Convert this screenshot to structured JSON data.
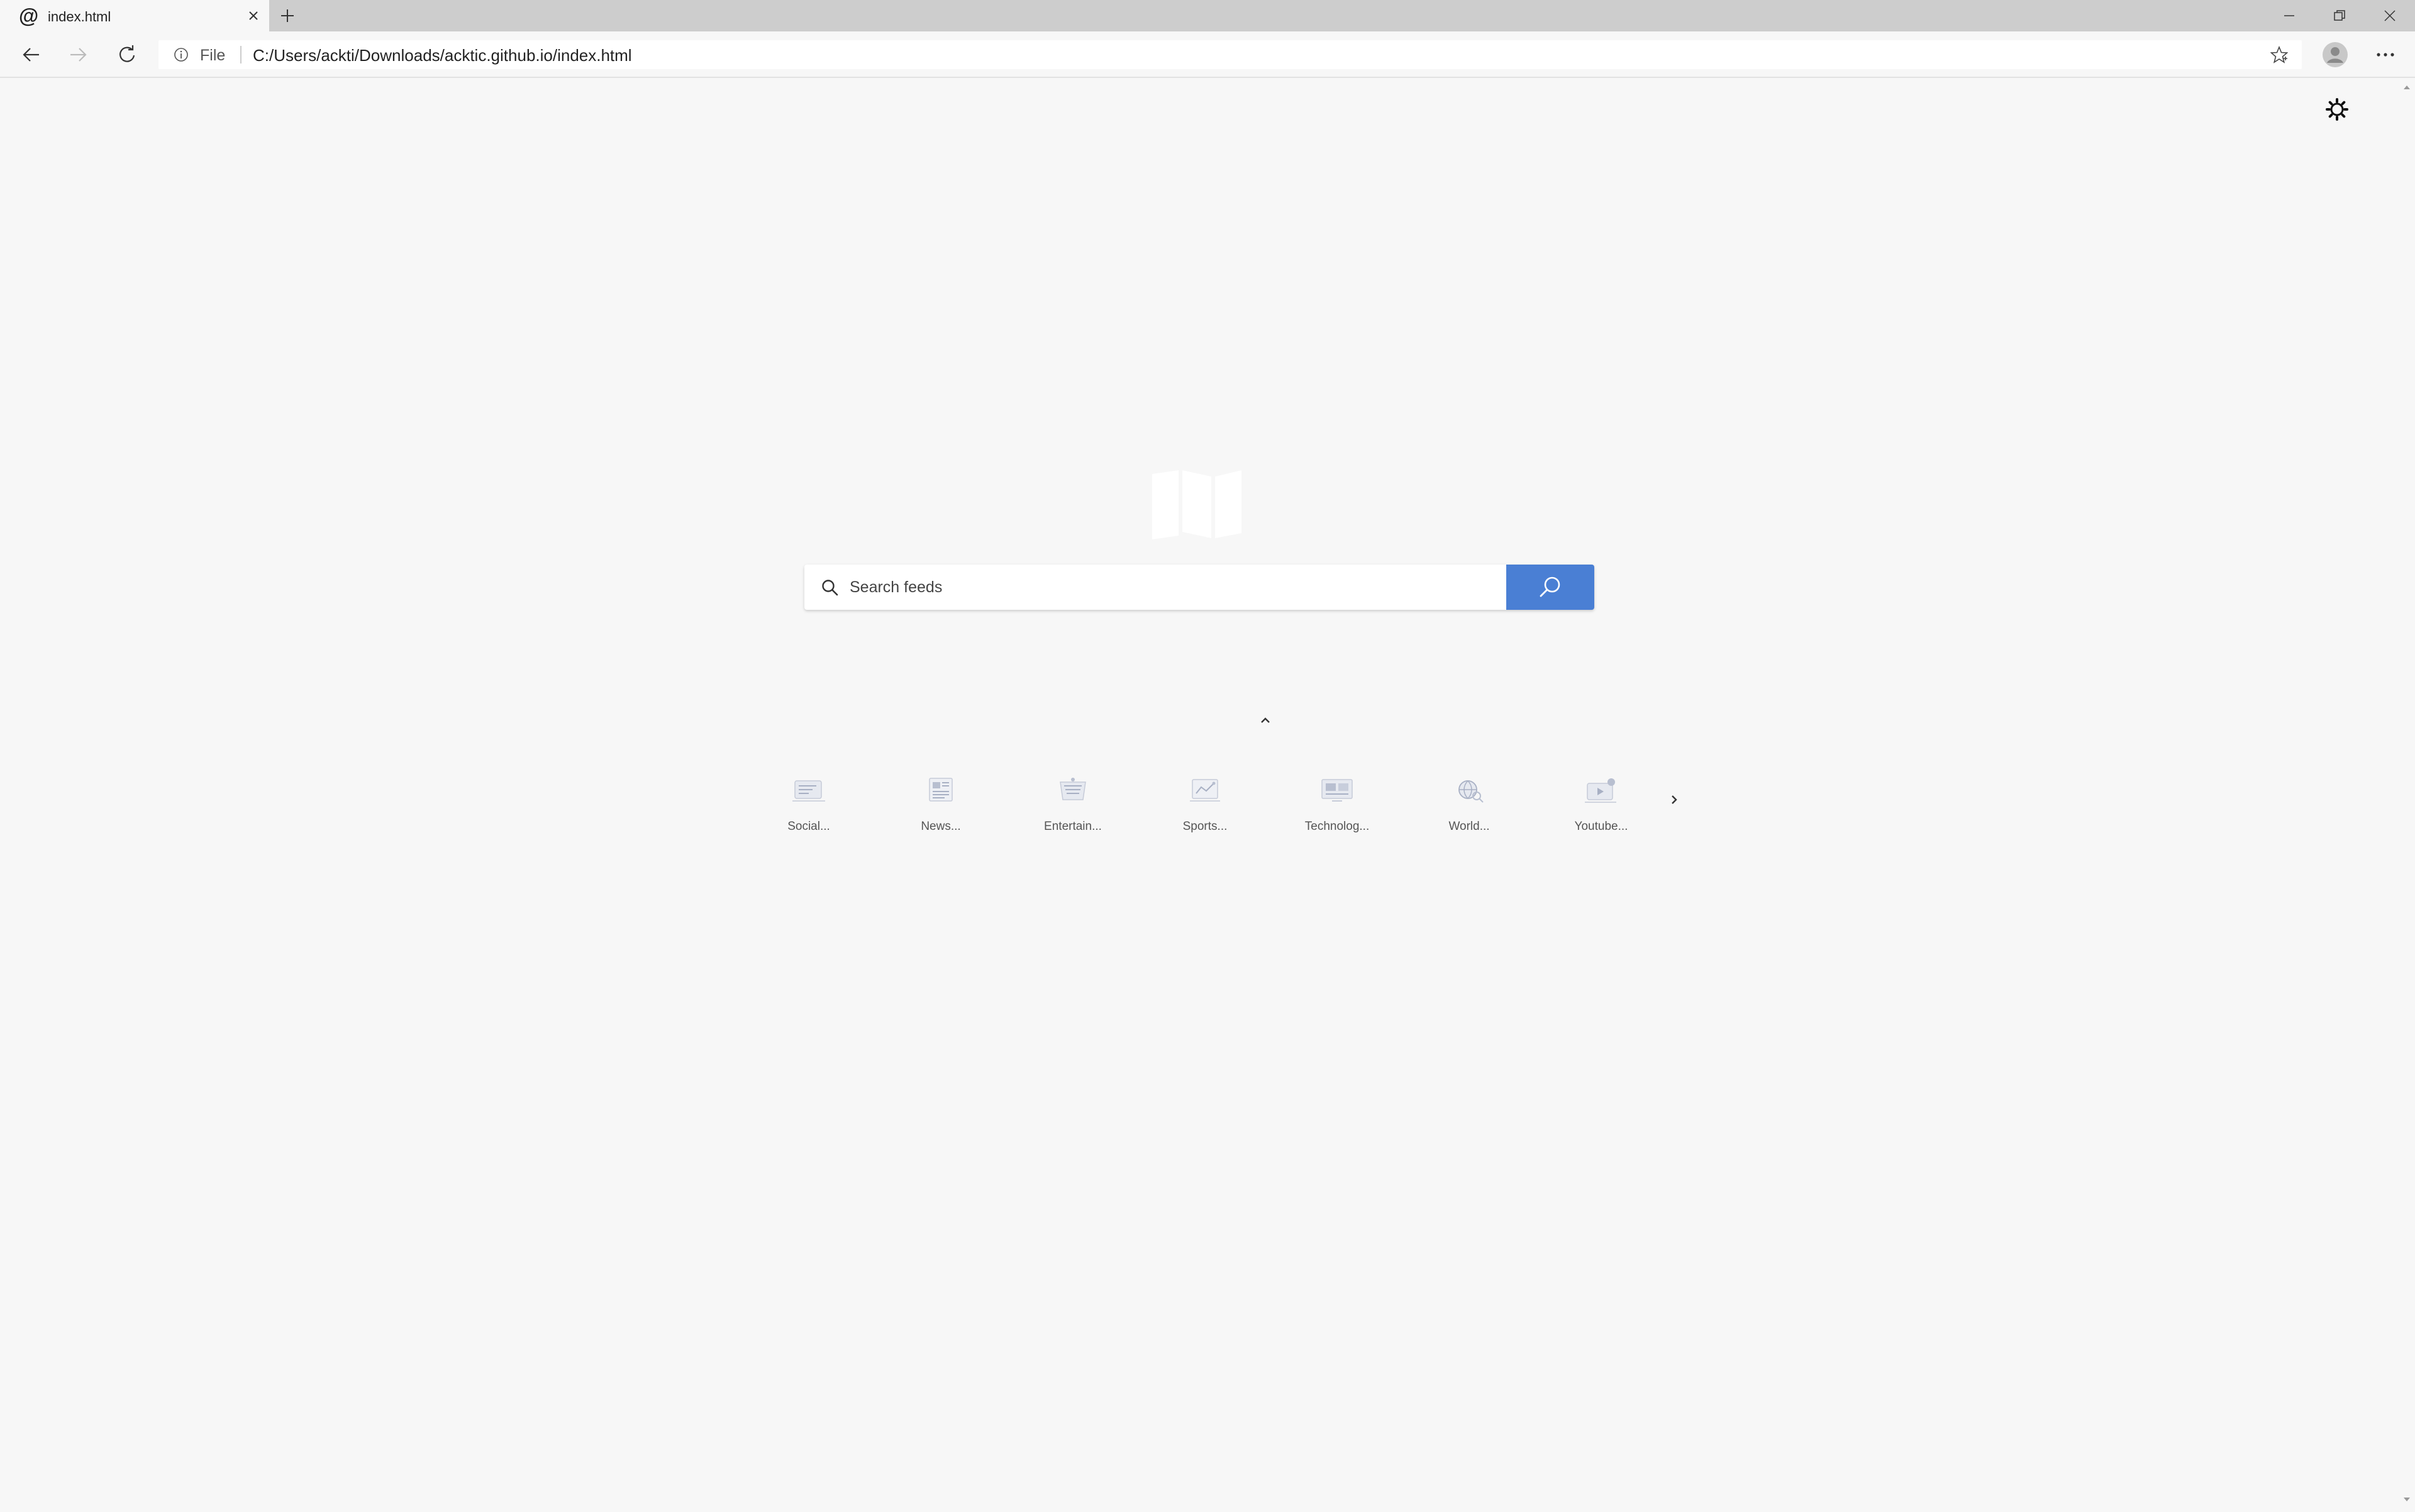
{
  "browser": {
    "tab": {
      "favicon": "@",
      "title": "index.html"
    },
    "address": {
      "scheme": "File",
      "url": "C:/Users/ackti/Downloads/acktic.github.io/index.html"
    }
  },
  "search": {
    "placeholder": "Search feeds",
    "button_color": "#4a7fd4"
  },
  "categories": [
    {
      "label": "Social...",
      "icon": "social-illustration-icon"
    },
    {
      "label": "News...",
      "icon": "news-illustration-icon"
    },
    {
      "label": "Entertain...",
      "icon": "entertainment-illustration-icon"
    },
    {
      "label": "Sports...",
      "icon": "sports-illustration-icon"
    },
    {
      "label": "Technolog...",
      "icon": "technology-illustration-icon"
    },
    {
      "label": "World...",
      "icon": "world-illustration-icon"
    },
    {
      "label": "Youtube...",
      "icon": "youtube-illustration-icon"
    }
  ]
}
